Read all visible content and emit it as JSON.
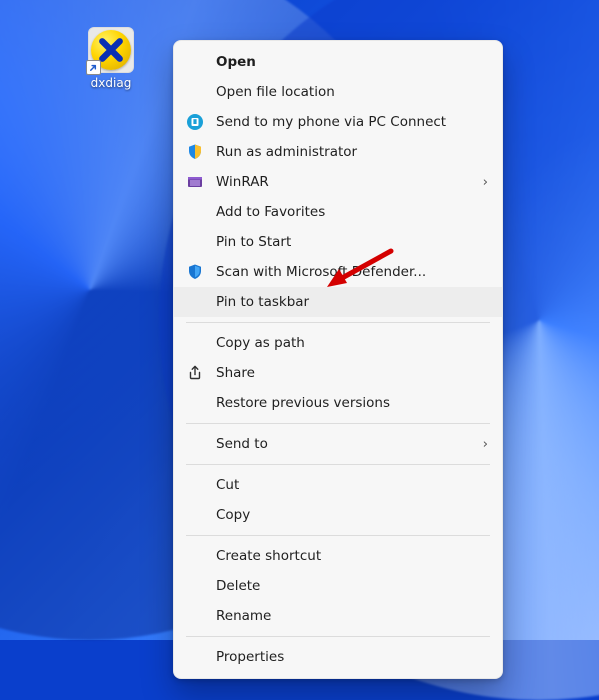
{
  "desktop": {
    "icon_label": "dxdiag"
  },
  "menu": {
    "open": "Open",
    "open_file_location": "Open file location",
    "pc_connect": "Send to my phone via PC Connect",
    "run_admin": "Run as administrator",
    "winrar": "WinRAR",
    "add_fav": "Add to Favorites",
    "pin_start": "Pin to Start",
    "defender": "Scan with Microsoft Defender...",
    "pin_taskbar": "Pin to taskbar",
    "copy_path": "Copy as path",
    "share": "Share",
    "restore_versions": "Restore previous versions",
    "send_to": "Send to",
    "cut": "Cut",
    "copy": "Copy",
    "new_shortcut": "Create shortcut",
    "delete": "Delete",
    "rename": "Rename",
    "properties": "Properties",
    "submenu_indicator": "›"
  }
}
